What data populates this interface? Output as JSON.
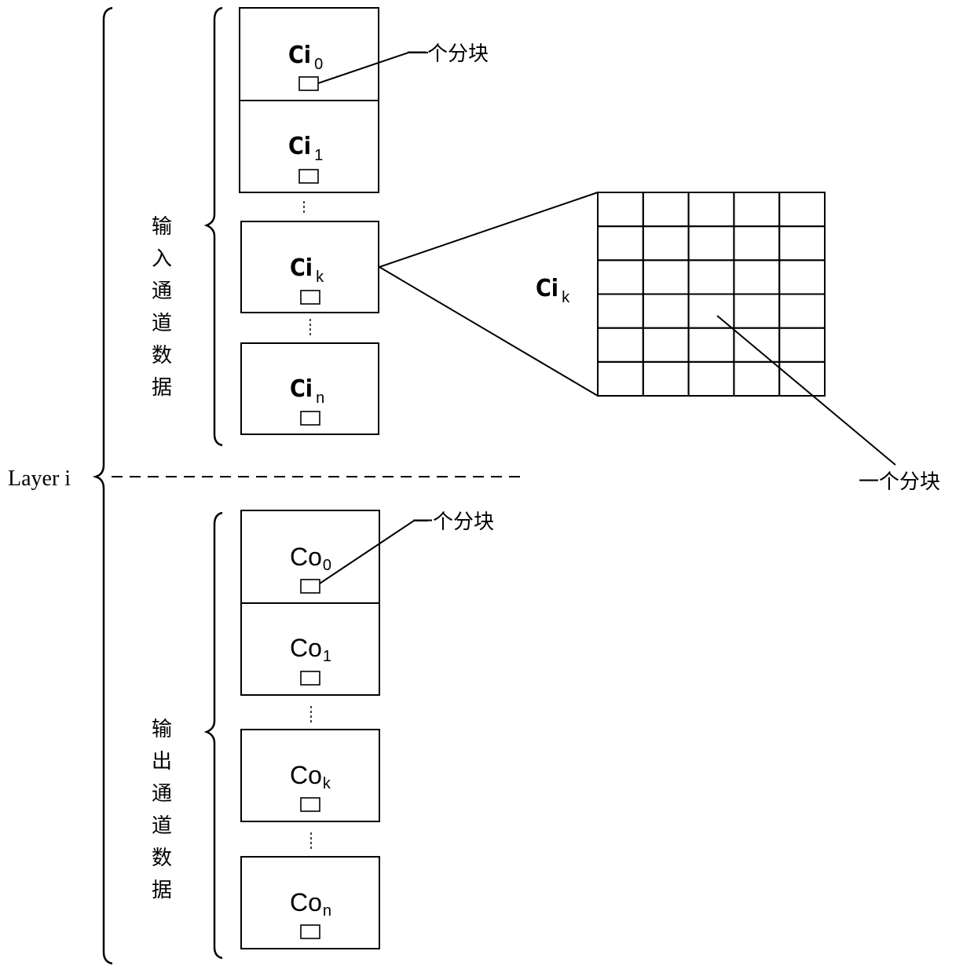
{
  "layer_label": "Layer i",
  "input_group": {
    "label_chars": [
      "输",
      "入",
      "通",
      "道",
      "数",
      "据"
    ],
    "channels": [
      {
        "base": "Ci",
        "sub": "0"
      },
      {
        "base": "Ci",
        "sub": "1"
      },
      {
        "base": "Ci",
        "sub": "k"
      },
      {
        "base": "Ci",
        "sub": "n"
      }
    ],
    "block_callout": "一个分块"
  },
  "output_group": {
    "label_chars": [
      "输",
      "出",
      "通",
      "道",
      "数",
      "据"
    ],
    "channels": [
      {
        "base": "Co",
        "sub": "0"
      },
      {
        "base": "Co",
        "sub": "1"
      },
      {
        "base": "Co",
        "sub": "k"
      },
      {
        "base": "Co",
        "sub": "n"
      }
    ],
    "block_callout": "一个分块"
  },
  "zoom_view": {
    "label_base": "Ci",
    "label_sub": "k",
    "grid_columns": 5,
    "grid_rows": 6,
    "block_callout": "一个分块"
  }
}
